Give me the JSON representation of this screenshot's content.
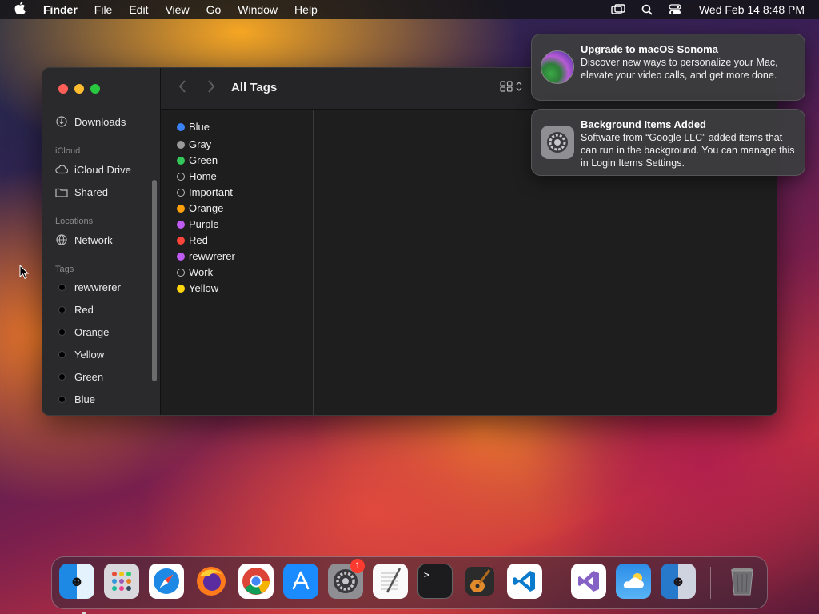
{
  "menubar": {
    "apple_icon": "apple-logo-icon",
    "items": [
      "Finder",
      "File",
      "Edit",
      "View",
      "Go",
      "Window",
      "Help"
    ],
    "clock": "Wed Feb 14  8:48 PM",
    "status_icons": [
      "screen-mirroring-icon",
      "search-icon",
      "control-center-icon"
    ]
  },
  "finder": {
    "title": "All Tags",
    "sidebar": {
      "top_items": [
        {
          "label": "Downloads",
          "icon": "download-icon"
        }
      ],
      "sections": [
        {
          "header": "iCloud",
          "items": [
            {
              "label": "iCloud Drive",
              "icon": "cloud-icon"
            },
            {
              "label": "Shared",
              "icon": "shared-folder-icon"
            }
          ]
        },
        {
          "header": "Locations",
          "items": [
            {
              "label": "Network",
              "icon": "network-globe-icon"
            }
          ]
        },
        {
          "header": "Tags",
          "items": [
            {
              "label": "rewwrerer"
            },
            {
              "label": "Red"
            },
            {
              "label": "Orange"
            },
            {
              "label": "Yellow"
            },
            {
              "label": "Green"
            },
            {
              "label": "Blue"
            }
          ]
        }
      ]
    },
    "tags": [
      {
        "label": "Blue",
        "color": "#3b82f6"
      },
      {
        "label": "Gray",
        "color": "#9a9a9a"
      },
      {
        "label": "Green",
        "color": "#34c759"
      },
      {
        "label": "Home",
        "color": ""
      },
      {
        "label": "Important",
        "color": ""
      },
      {
        "label": "Orange",
        "color": "#ff9f0a"
      },
      {
        "label": "Purple",
        "color": "#bf5af2"
      },
      {
        "label": "Red",
        "color": "#ff453a"
      },
      {
        "label": "rewwrerer",
        "color": "#bf5af2"
      },
      {
        "label": "Work",
        "color": ""
      },
      {
        "label": "Yellow",
        "color": "#ffd60a"
      }
    ]
  },
  "notifications": [
    {
      "title": "Upgrade to macOS Sonoma",
      "body": "Discover new ways to personalize your Mac, elevate your video calls, and get more done.",
      "icon": "macos-sonoma-icon"
    },
    {
      "title": "Background Items Added",
      "body": "Software from “Google LLC” added items that can run in the background. You can manage this in Login Items Settings.",
      "icon": "system-settings-gear-icon"
    }
  ],
  "dock": {
    "apps": [
      "Finder",
      "Launchpad",
      "Safari",
      "Firefox",
      "Chrome",
      "App Store",
      "System Settings",
      "TextEdit",
      "Terminal",
      "GarageBand",
      "Visual Studio Code",
      "Visual Studio",
      "Weather",
      "Finder",
      "Trash"
    ],
    "system_settings_badge": "1"
  }
}
